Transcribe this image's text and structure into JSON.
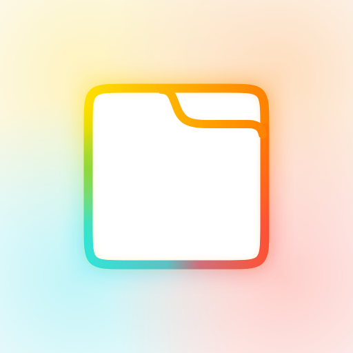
{
  "icon": {
    "name": "folder-icon",
    "colors": {
      "background": "#fbfbfb",
      "fill": "#ffffff",
      "yellow": "#ffd400",
      "orange": "#ff8a00",
      "red": "#ff4a3d",
      "cyan": "#1fe3f0",
      "green": "#7fd63a",
      "mauve": "#d85c7a"
    }
  }
}
